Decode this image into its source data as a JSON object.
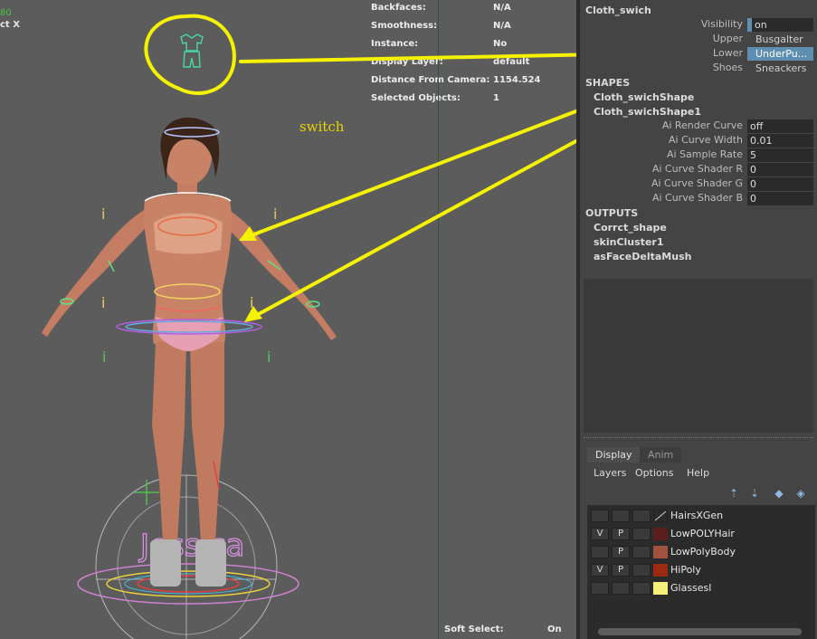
{
  "viewport": {
    "corner_lines": [
      "80",
      "ct X"
    ],
    "hud": [
      {
        "key": "Backfaces:",
        "value": "N/A"
      },
      {
        "key": "Smoothness:",
        "value": "N/A"
      },
      {
        "key": "Instance:",
        "value": "No"
      },
      {
        "key": "Display Layer:",
        "value": "default"
      },
      {
        "key": "Distance From Camera:",
        "value": "1154.524"
      },
      {
        "key": "Selected Objects:",
        "value": "1"
      }
    ],
    "soft_select": {
      "key": "Soft Select:",
      "value": "On"
    },
    "annotation": "switch",
    "character_name": "Jessica",
    "annotation_color": "#f5f200"
  },
  "attribute_editor": {
    "node_name": "Cloth_swich",
    "rows": [
      {
        "label": "Visibility",
        "value": "on"
      },
      {
        "label": "Upper",
        "value": "Busgalter"
      },
      {
        "label": "Lower",
        "value": "UnderPu..."
      },
      {
        "label": "Shoes",
        "value": "Sneackers"
      }
    ],
    "shapes_header": "SHAPES",
    "shapes": [
      "Cloth_swichShape",
      "Cloth_swichShape1"
    ],
    "shape_attrs": [
      {
        "label": "Ai Render Curve",
        "value": "off"
      },
      {
        "label": "Ai Curve Width",
        "value": "0.01"
      },
      {
        "label": "Ai Sample Rate",
        "value": "5"
      },
      {
        "label": "Ai Curve Shader R",
        "value": "0"
      },
      {
        "label": "Ai Curve Shader G",
        "value": "0"
      },
      {
        "label": "Ai Curve Shader B",
        "value": "0"
      }
    ],
    "outputs_header": "OUTPUTS",
    "outputs": [
      "Corrct_shape",
      "skinCluster1",
      "asFaceDeltaMush"
    ],
    "selected_color": "#5f8fb0"
  },
  "layer_editor": {
    "tabs": [
      "Display",
      "Anim"
    ],
    "menu": [
      "Layers",
      "Options",
      "Help"
    ],
    "toolbar_icons": [
      "move-layer-up-icon",
      "move-layer-down-icon",
      "new-layer-icon",
      "new-layer-selected-icon"
    ],
    "layers": [
      {
        "v": "",
        "p": "",
        "name": "HairsXGen",
        "color": "none"
      },
      {
        "v": "V",
        "p": "P",
        "name": "LowPOLYHair",
        "color": "#5a1e1e"
      },
      {
        "v": "",
        "p": "P",
        "name": "LowPolyBody",
        "color": "#a0523e"
      },
      {
        "v": "V",
        "p": "P",
        "name": "HiPoly",
        "color": "#9c2a10"
      },
      {
        "v": "",
        "p": "",
        "name": "Glassesl",
        "color": "#f4f07a"
      }
    ]
  }
}
